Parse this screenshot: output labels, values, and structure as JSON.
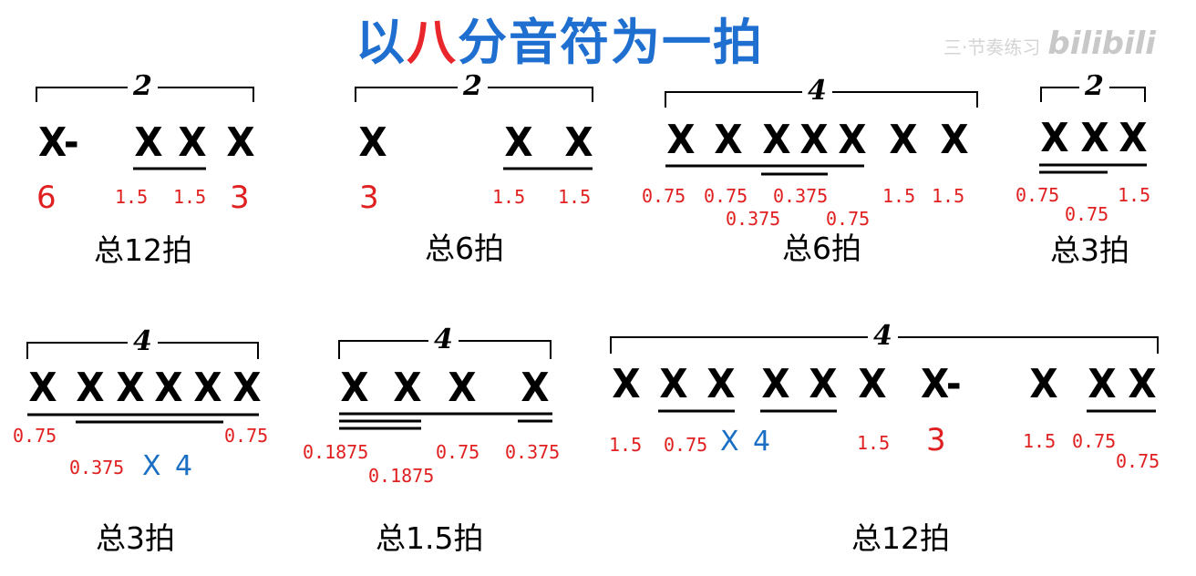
{
  "title": {
    "parts": [
      {
        "text": "以",
        "color": "#1f6fd0"
      },
      {
        "text": "八",
        "color": "#e8262b"
      },
      {
        "text": "分音符为一拍",
        "color": "#1f6fd0"
      }
    ]
  },
  "watermark": {
    "text": "三·节奏练习",
    "logo": "bilibili"
  },
  "groups": [
    {
      "tuplet": "2",
      "notes": [
        "X-",
        "X",
        "X",
        "X"
      ],
      "labels": [
        "6",
        "1.5",
        "1.5",
        "3"
      ],
      "total": "总12拍"
    },
    {
      "tuplet": "2",
      "notes": [
        "X",
        "X",
        "X"
      ],
      "labels": [
        "3",
        "1.5",
        "1.5"
      ],
      "total": "总6拍"
    },
    {
      "tuplet": "4",
      "notes": [
        "X",
        "X",
        "X",
        "X",
        "X",
        "X",
        "X"
      ],
      "labels": [
        "0.75",
        "0.75",
        "0.375",
        "0.375",
        "0.75",
        "1.5",
        "1.5"
      ],
      "total": "总6拍"
    },
    {
      "tuplet": "2",
      "notes": [
        "X",
        "X",
        "X"
      ],
      "labels": [
        "0.75",
        "0.75",
        "1.5"
      ],
      "total": "总3拍"
    },
    {
      "tuplet": "4",
      "notes": [
        "X",
        "X",
        "X",
        "X",
        "X",
        "X"
      ],
      "labels": [
        "0.75",
        "0.375",
        "X",
        "4",
        "0.75"
      ],
      "total": "总3拍"
    },
    {
      "tuplet": "4",
      "notes": [
        "X",
        "X",
        "X",
        "X"
      ],
      "labels": [
        "0.1875",
        "0.1875",
        "0.75",
        "0.375"
      ],
      "total": "总1.5拍"
    },
    {
      "tuplet": "4",
      "notes": [
        "X",
        "X",
        "X",
        "X",
        "X",
        "X",
        "X-",
        "X",
        "X",
        "X"
      ],
      "labels": [
        "1.5",
        "0.75",
        "X",
        "4",
        "1.5",
        "3",
        "1.5",
        "0.75",
        "0.75"
      ],
      "total": "总12拍"
    }
  ]
}
